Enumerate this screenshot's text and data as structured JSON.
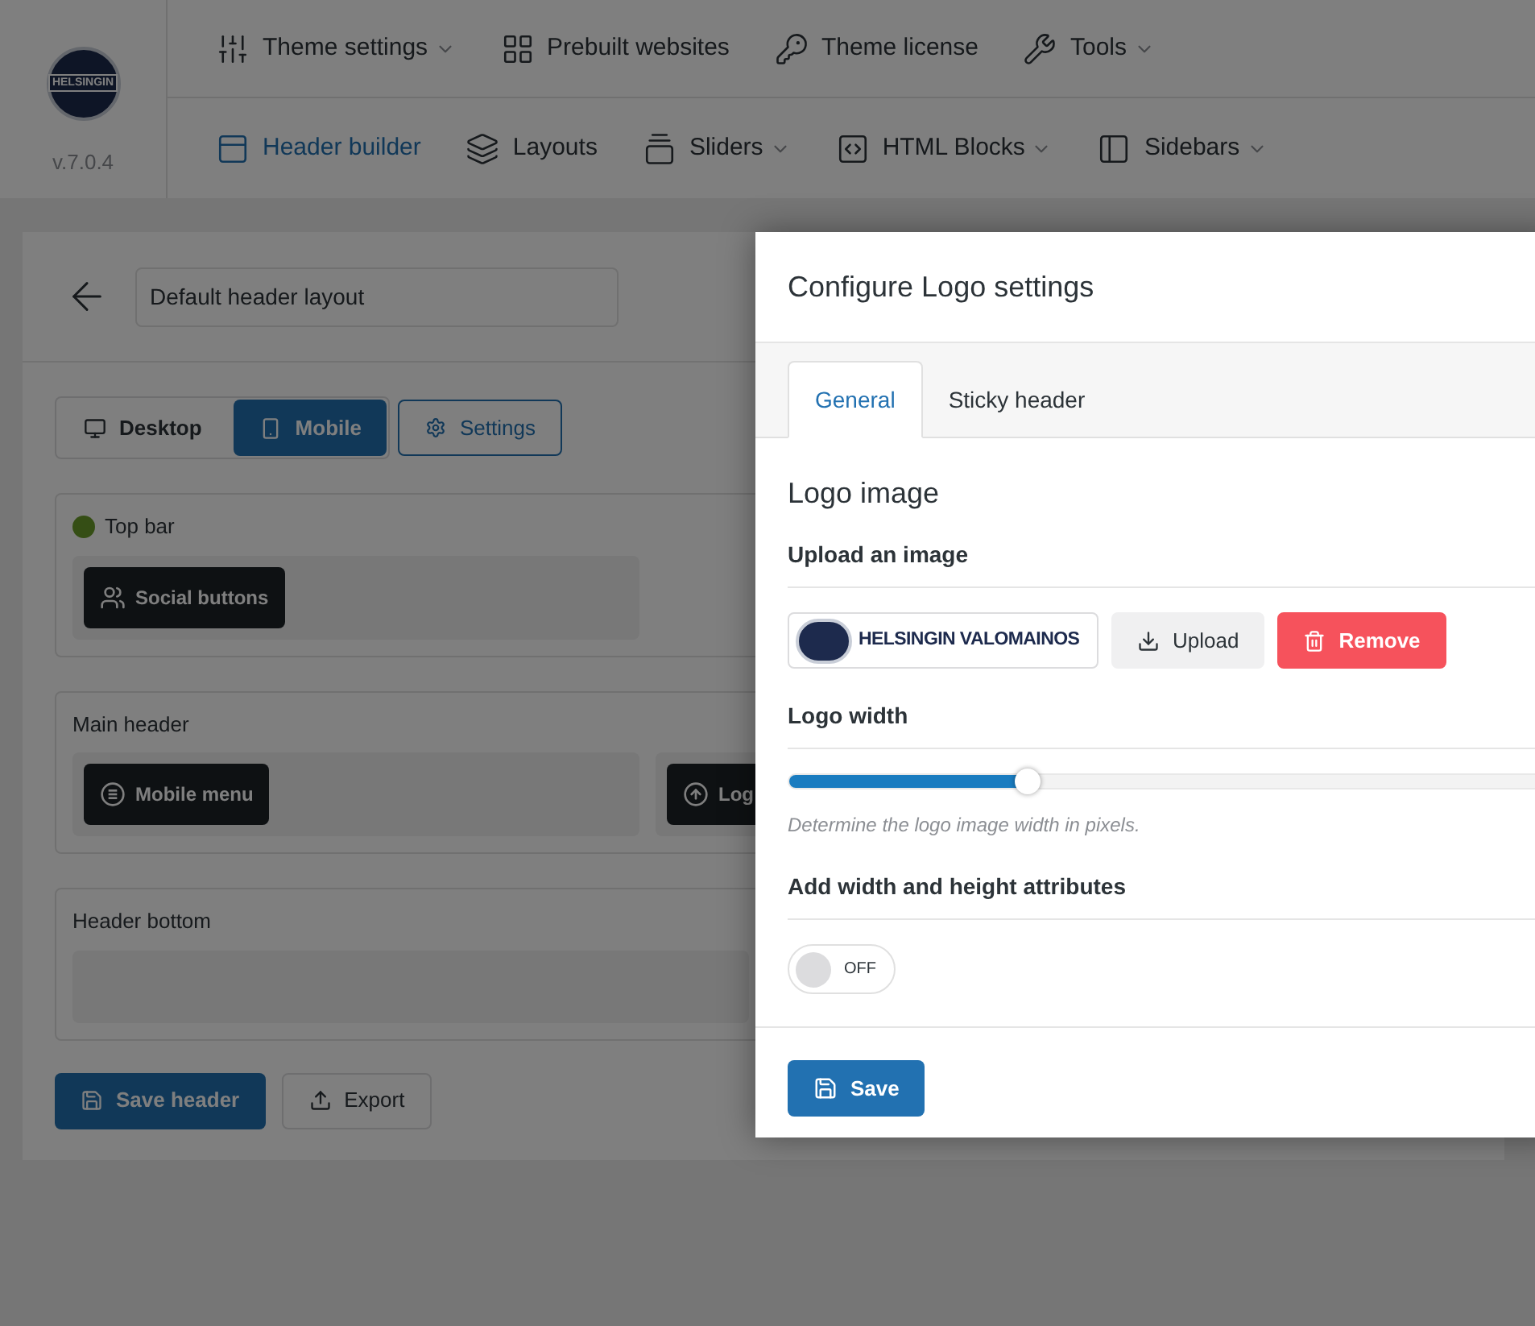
{
  "brand": {
    "logo_text": "HELSINGIN",
    "version": "v.7.0.4"
  },
  "nav_primary": [
    {
      "label": "Theme settings",
      "dropdown": true
    },
    {
      "label": "Prebuilt websites",
      "dropdown": false
    },
    {
      "label": "Theme license",
      "dropdown": false
    },
    {
      "label": "Tools",
      "dropdown": true
    }
  ],
  "nav_secondary": [
    {
      "label": "Header builder",
      "dropdown": false,
      "selected": true
    },
    {
      "label": "Layouts",
      "dropdown": false,
      "selected": false
    },
    {
      "label": "Sliders",
      "dropdown": true,
      "selected": false
    },
    {
      "label": "HTML Blocks",
      "dropdown": true,
      "selected": false
    },
    {
      "label": "Sidebars",
      "dropdown": true,
      "selected": false
    }
  ],
  "editor": {
    "layout_name": "Default header layout",
    "view_modes": [
      {
        "label": "Desktop",
        "selected": false
      },
      {
        "label": "Mobile",
        "selected": true
      }
    ],
    "settings_button": "Settings",
    "rows": [
      {
        "title": "Top bar",
        "active": true,
        "zones": [
          {
            "elements": [
              {
                "label": "Social buttons",
                "kind": "social"
              }
            ]
          }
        ]
      },
      {
        "title": "Main header",
        "active": false,
        "zones": [
          {
            "elements": [
              {
                "label": "Mobile menu",
                "kind": "menu"
              }
            ]
          },
          {
            "elements": [
              {
                "label": "Log",
                "kind": "logo"
              }
            ]
          }
        ]
      },
      {
        "title": "Header bottom",
        "active": false,
        "zones": [
          {
            "empty": true
          }
        ]
      }
    ],
    "save_button": "Save header",
    "export_button": "Export"
  },
  "modal": {
    "title": "Configure Logo settings",
    "tabs": [
      {
        "label": "General",
        "selected": true
      },
      {
        "label": "Sticky header",
        "selected": false
      }
    ],
    "section_title": "Logo image",
    "upload_label": "Upload an image",
    "logo_preview_text": "HELSINGIN VALOMAINOS",
    "upload_button": "Upload",
    "remove_button": "Remove",
    "width_label": "Logo width",
    "width_slider": {
      "level": 0.31
    },
    "width_hint": "Determine the logo image width in pixels.",
    "attributes_label": "Add width and height attributes",
    "attributes_toggle": {
      "on": false,
      "label": "OFF"
    },
    "save_button": "Save"
  }
}
